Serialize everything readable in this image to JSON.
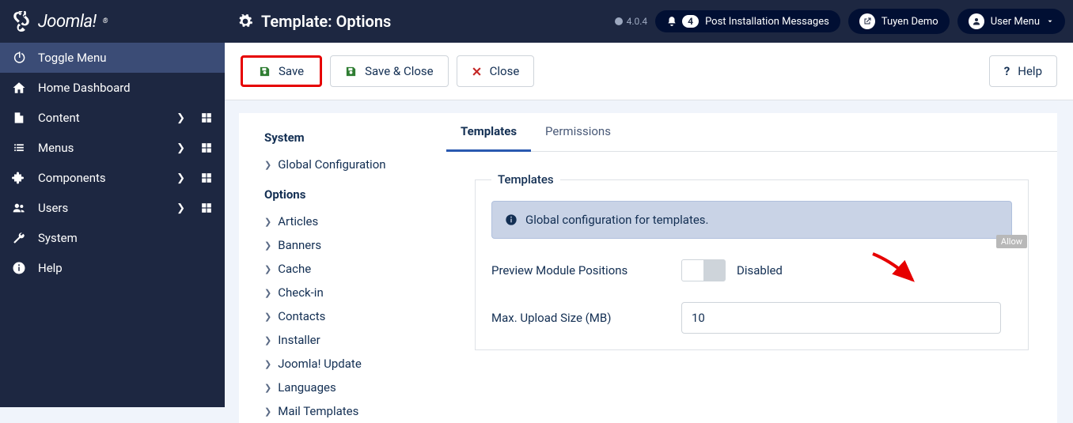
{
  "brand": "Joomla!",
  "page_title": "Template: Options",
  "version": "4.0.4",
  "top": {
    "notif_count": "4",
    "notif_label": "Post Installation Messages",
    "demo_label": "Tuyen Demo",
    "user_menu": "User Menu"
  },
  "sidebar": {
    "items": [
      {
        "label": "Toggle Menu",
        "icon": "power"
      },
      {
        "label": "Home Dashboard",
        "icon": "home"
      },
      {
        "label": "Content",
        "icon": "file",
        "expand": true,
        "grid": true
      },
      {
        "label": "Menus",
        "icon": "list",
        "expand": true,
        "grid": true
      },
      {
        "label": "Components",
        "icon": "puzzle",
        "expand": true,
        "grid": true
      },
      {
        "label": "Users",
        "icon": "users",
        "expand": true,
        "grid": true
      },
      {
        "label": "System",
        "icon": "wrench"
      },
      {
        "label": "Help",
        "icon": "info"
      }
    ]
  },
  "toolbar": {
    "save": "Save",
    "save_close": "Save & Close",
    "close": "Close",
    "help": "Help"
  },
  "left_panel": {
    "h1": "System",
    "i1": "Global Configuration",
    "h2": "Options",
    "items": [
      "Articles",
      "Banners",
      "Cache",
      "Check-in",
      "Contacts",
      "Installer",
      "Joomla! Update",
      "Languages",
      "Mail Templates"
    ]
  },
  "tabs": {
    "templates": "Templates",
    "permissions": "Permissions"
  },
  "fieldset": {
    "legend": "Templates",
    "info": "Global configuration for templates.",
    "allow": "Allow",
    "preview_label": "Preview Module Positions",
    "preview_state": "Disabled",
    "upload_label": "Max. Upload Size (MB)",
    "upload_value": "10"
  }
}
